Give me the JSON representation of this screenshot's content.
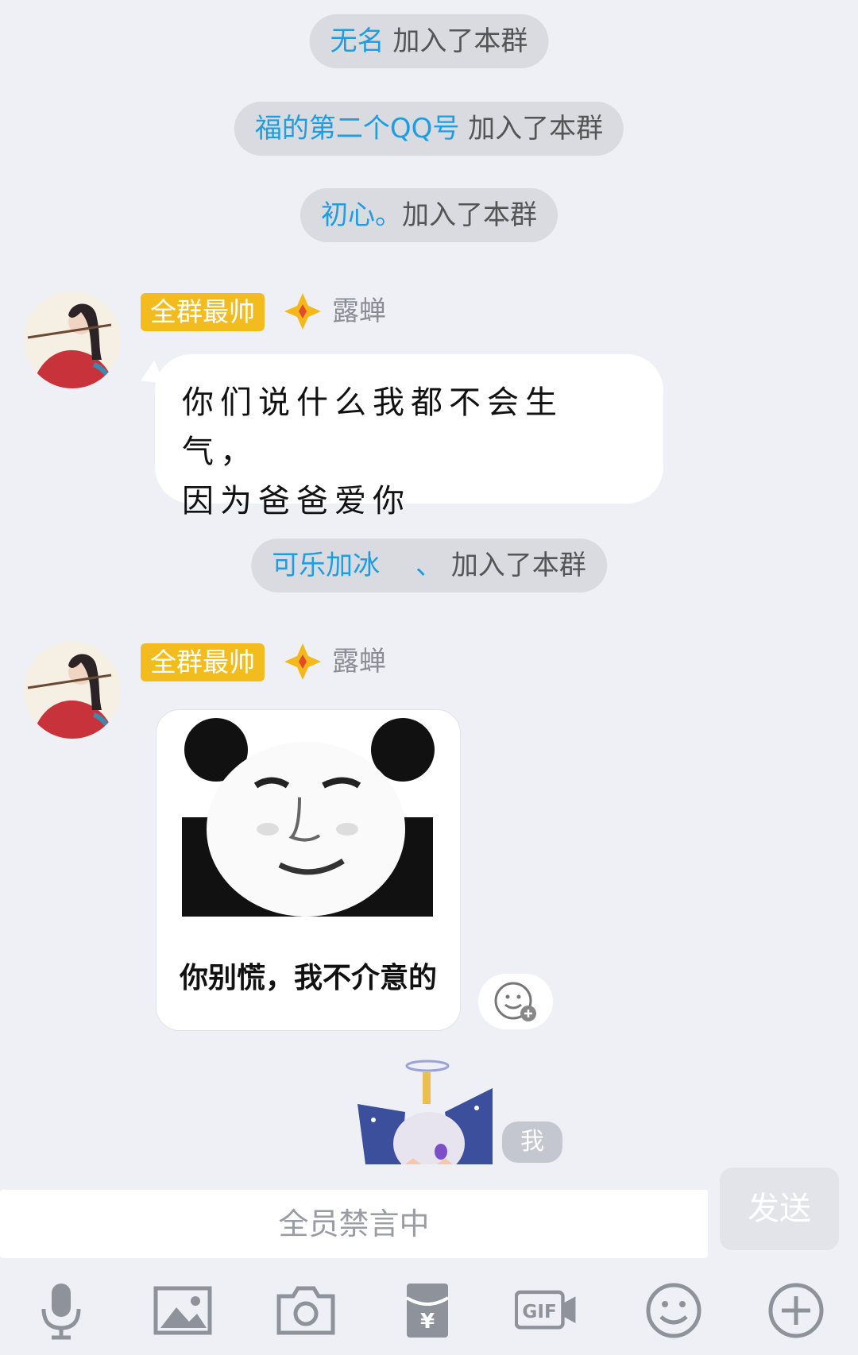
{
  "system_messages": [
    {
      "who": "无名",
      "action": "加入了本群"
    },
    {
      "who": "福的第二个QQ号",
      "action": "加入了本群"
    },
    {
      "who": "初心。",
      "action": "加入了本群"
    },
    {
      "who": "可乐加冰 　、",
      "action": "加入了本群"
    }
  ],
  "messages": [
    {
      "badge": "全群最帅",
      "sender": "露蝉",
      "text_line1": "你们说什么我都不会生气，",
      "text_line2": "因为爸爸爱你"
    },
    {
      "badge": "全群最帅",
      "sender": "露蝉",
      "sticker_caption": "你别慌，我不介意的"
    }
  ],
  "me_label": "我",
  "input": {
    "placeholder": "全员禁言中"
  },
  "send_label": "发送",
  "colors": {
    "background": "#eef0f5",
    "link": "#1e9de0",
    "badge": "#f2bc1f",
    "system_pill": "#d9dbe1"
  },
  "toolbar": [
    "microphone-icon",
    "image-icon",
    "camera-icon",
    "red-packet-icon",
    "gif-icon",
    "emoji-icon",
    "plus-icon"
  ]
}
